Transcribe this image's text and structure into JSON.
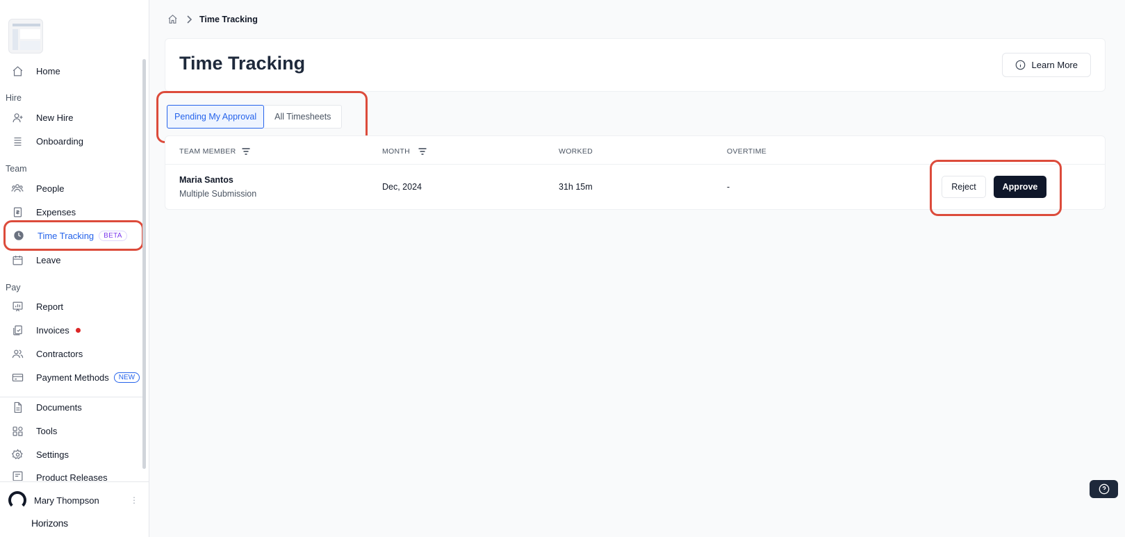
{
  "sidebar": {
    "home": "Home",
    "sections": {
      "hire": "Hire",
      "team": "Team",
      "pay": "Pay"
    },
    "new_hire": "New Hire",
    "onboarding": "Onboarding",
    "people": "People",
    "expenses": "Expenses",
    "time_tracking": "Time Tracking",
    "time_tracking_badge": "BETA",
    "leave": "Leave",
    "report": "Report",
    "invoices": "Invoices",
    "contractors": "Contractors",
    "payment_methods": "Payment Methods",
    "payment_methods_badge": "NEW",
    "documents": "Documents",
    "tools": "Tools",
    "settings": "Settings",
    "product_releases": "Product Releases",
    "user_name": "Mary Thompson",
    "brand": "Horizons"
  },
  "breadcrumb": {
    "current": "Time Tracking"
  },
  "header": {
    "title": "Time Tracking",
    "learn_more": "Learn More"
  },
  "tabs": [
    {
      "label": "Pending My Approval",
      "active": true
    },
    {
      "label": "All Timesheets",
      "active": false
    }
  ],
  "table": {
    "columns": [
      "TEAM MEMBER",
      "MONTH",
      "WORKED",
      "OVERTIME"
    ],
    "rows": [
      {
        "name": "Maria Santos",
        "sub": "Multiple Submission",
        "month": "Dec, 2024",
        "worked": "31h 15m",
        "overtime": "-",
        "reject": "Reject",
        "approve": "Approve"
      }
    ]
  },
  "colors": {
    "accent": "#2563eb",
    "annotation": "#dc4b3b",
    "primary_button": "#0f172a",
    "notification_dot": "#dc2626"
  }
}
